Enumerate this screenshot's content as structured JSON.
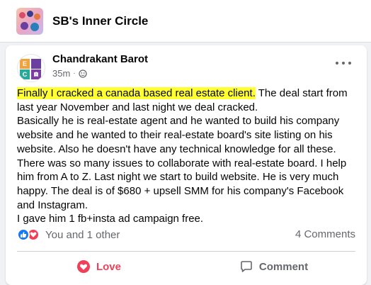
{
  "group": {
    "name": "SB's Inner Circle"
  },
  "post": {
    "author": "Chandrakant Barot",
    "time": "35m",
    "visibility_icon": "group-icon",
    "text": {
      "highlighted": "Finally I cracked a canada based real estate client.",
      "rest": " The deal start from last year November and last night we deal cracked.",
      "lines": [
        "Basically he is real-estate agent and he wanted to build his company website and he wanted to their real-estate board's site listing on his website. Also he doesn't have any technical knowledge for all these. There was so many issues to collaborate with real-estate board. I help him from A to Z. Last night we start to build website. He is very much happy. The deal is of $680 + upsell SMM for his company's Facebook and Instagram.",
        "I gave him 1 fb+insta ad campaign free."
      ]
    },
    "reactions": {
      "summary": "You and 1 other",
      "types": [
        "like",
        "love"
      ]
    },
    "comment_count": "4 Comments",
    "actions": {
      "love_label": "Love",
      "comment_label": "Comment"
    }
  },
  "colors": {
    "highlight": "#ffff32",
    "love": "#f33e58",
    "like": "#1877f2",
    "secondary_text": "#65676b"
  }
}
